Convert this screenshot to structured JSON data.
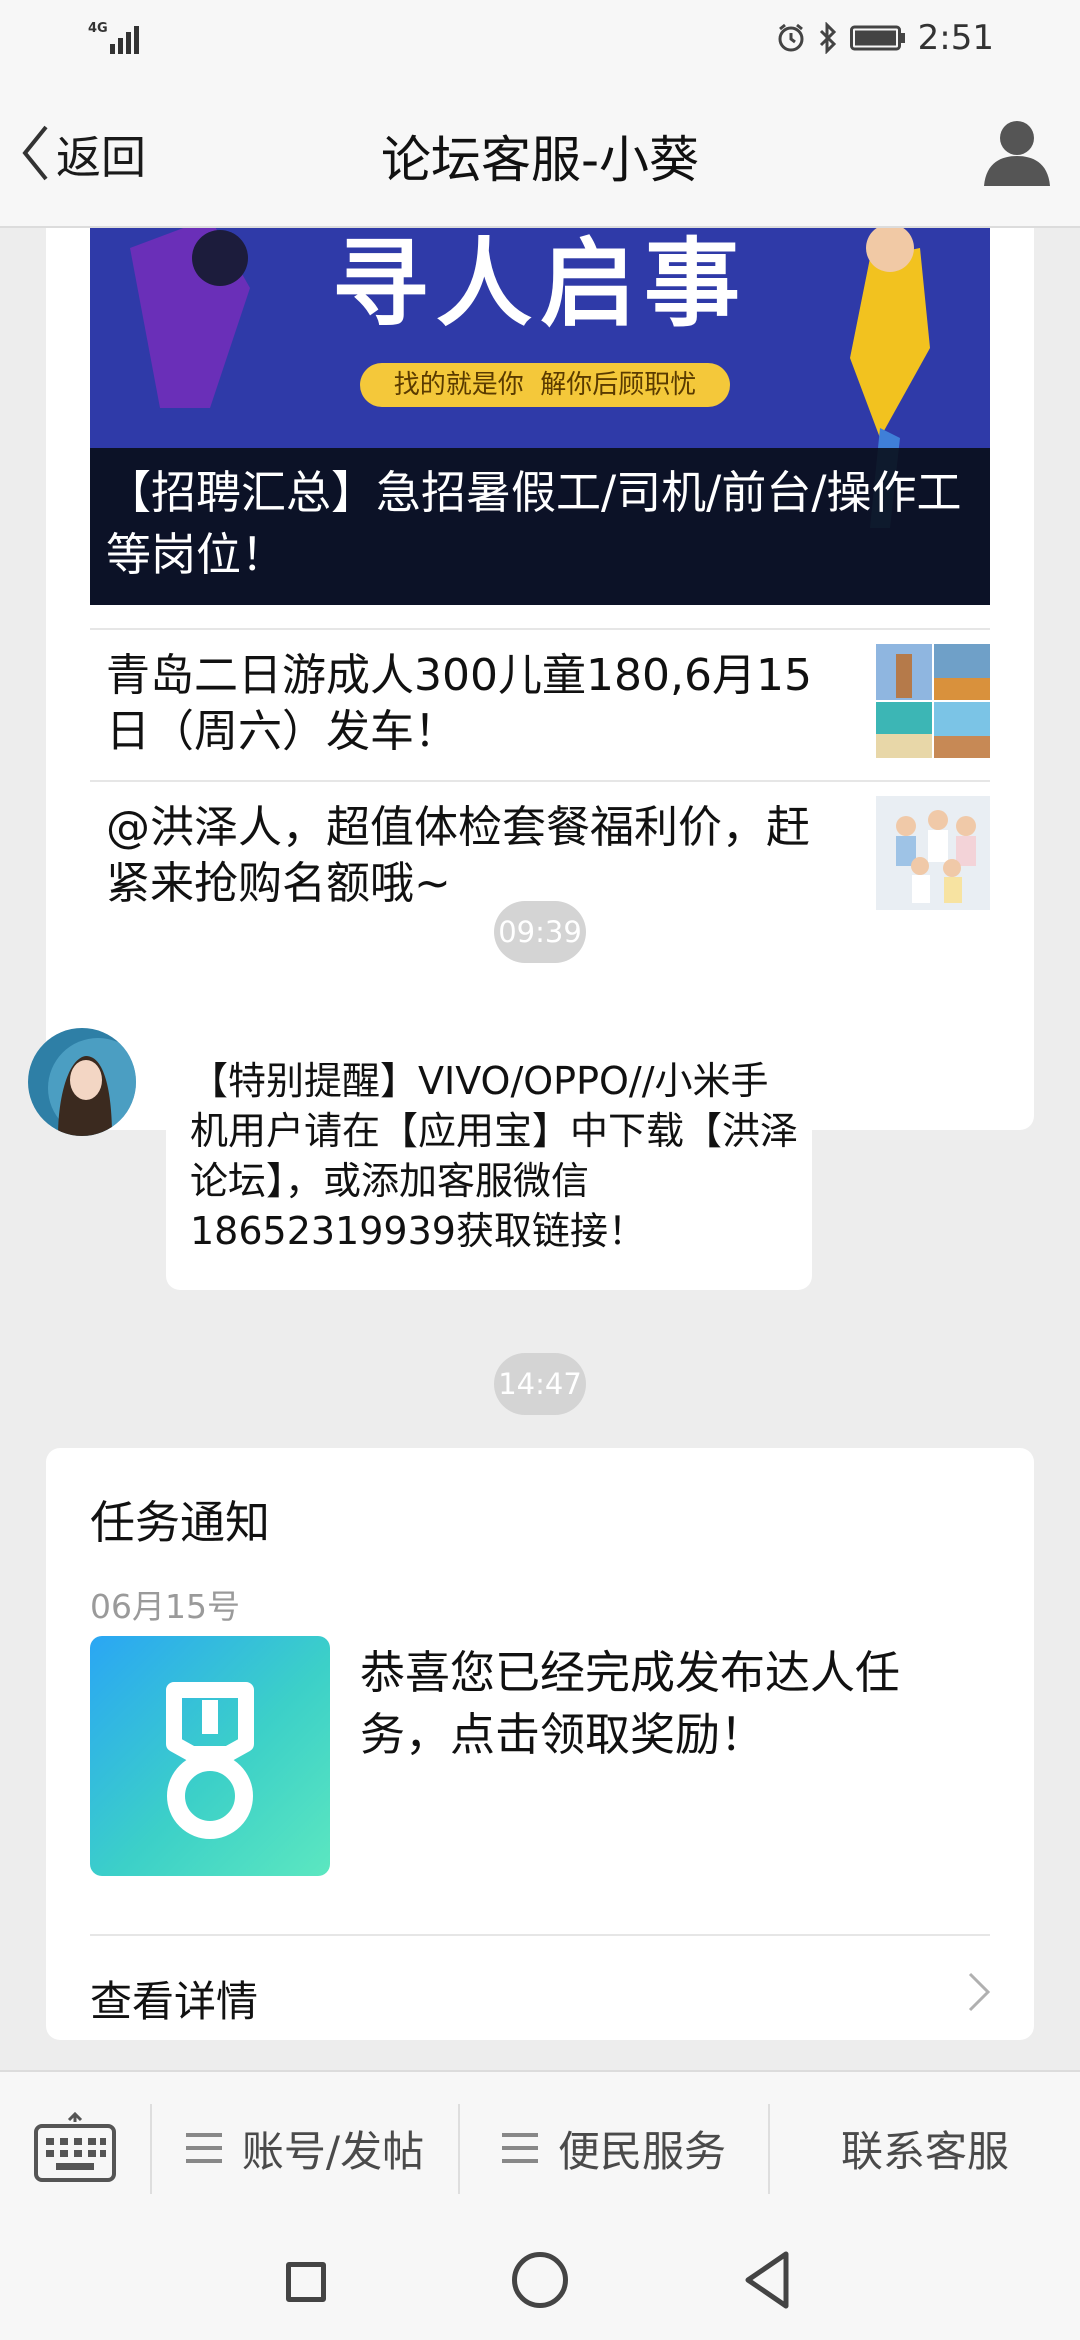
{
  "status_bar": {
    "network": "4G",
    "time": "2:51"
  },
  "nav": {
    "back_label": "返回",
    "title": "论坛客服-小葵"
  },
  "news_card": {
    "banner_headline": "寻人启事",
    "banner_tagline": "找的就是你  解你后顾职忧",
    "banner_caption": "【招聘汇总】急招暑假工/司机/前台/操作工等岗位！",
    "items": [
      {
        "text": "青岛二日游成人300儿童180,6月15日（周六）发车！"
      },
      {
        "text": "@洪泽人，超值体检套餐福利价，赶紧来抢购名额哦~"
      }
    ]
  },
  "messages": {
    "time1": "09:39",
    "text_message": "【特别提醒】VIVO/OPPO//小米手机用户请在【应用宝】中下载【洪泽论坛】，或添加客服微信18652319939获取链接！",
    "time2": "14:47"
  },
  "task_card": {
    "title": "任务通知",
    "date": "06月15号",
    "description": "恭喜您已经完成发布达人任务，点击领取奖励！",
    "detail_label": "查看详情"
  },
  "menu": {
    "items": [
      {
        "label": "账号/发帖"
      },
      {
        "label": "便民服务"
      },
      {
        "label": "联系客服"
      }
    ]
  }
}
